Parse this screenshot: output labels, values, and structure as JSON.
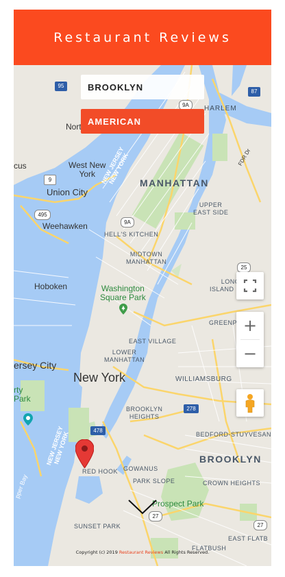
{
  "header": {
    "title": "Restaurant Reviews"
  },
  "filters": {
    "neighborhood": "BROOKLYN",
    "cuisine": "AMERICAN"
  },
  "map": {
    "labels": {
      "manhattan": "MANHATTAN",
      "harlem": "HARLEM",
      "north_bergen": "North Bergen",
      "west_new_york": "West New\nYork",
      "union_city": "Union City",
      "weehawken": "Weehawken",
      "new_jersey_ny_north": "NEW JERSEY\nNEW YORK",
      "upper_east_side": "UPPER\nEAST SIDE",
      "hells_kitchen": "HELL'S KITCHEN",
      "midtown_manhattan": "MIDTOWN\nMANHATTAN",
      "long_island_city": "LONG\nISLAND CITY",
      "hoboken": "Hoboken",
      "washington_square_park": "Washington\nSquare Park",
      "greenpoint": "GREENPOINT",
      "east_village": "EAST VILLAGE",
      "lower_manhattan": "LOWER\nMANHATTAN",
      "jersey_city": "ersey City",
      "new_york": "New York",
      "williamsburg": "WILLIAMSBURG",
      "liberty_state_park": "rty\nPark",
      "brooklyn_heights": "BROOKLYN\nHEIGHTS",
      "new_jersey_ny_south": "NEW JERSEY\nNEW YORK",
      "bedford_stuyvesant": "BEDFORD-STUYVESANT",
      "brooklyn": "BROOKLYN",
      "red_hook": "RED HOOK",
      "gowanus": "GOWANUS",
      "park_slope": "PARK SLOPE",
      "crown_heights": "CROWN HEIGHTS",
      "prospect_park": "Prospect Park",
      "sunset_park": "SUNSET PARK",
      "east_flatbush": "EAST FLATB",
      "flatbush": "FLATBUSH",
      "upper_bay": "pper Bay",
      "fdr_dr": "FDR Dr",
      "cus": "cus",
      "m95": "95",
      "m87": "87",
      "m9a_top": "9A",
      "m9a_mid": "9A",
      "m9": "9",
      "m495": "495",
      "m25": "25",
      "m278": "278",
      "m478": "478",
      "m27": "27",
      "m27b": "27"
    }
  },
  "controls": {
    "zoom_in": "+",
    "zoom_out": "−"
  },
  "footer": {
    "prefix": "Copyright (c) 2019 ",
    "brand": "Restaurant Reviews",
    "suffix": " All Rights Reserved."
  }
}
